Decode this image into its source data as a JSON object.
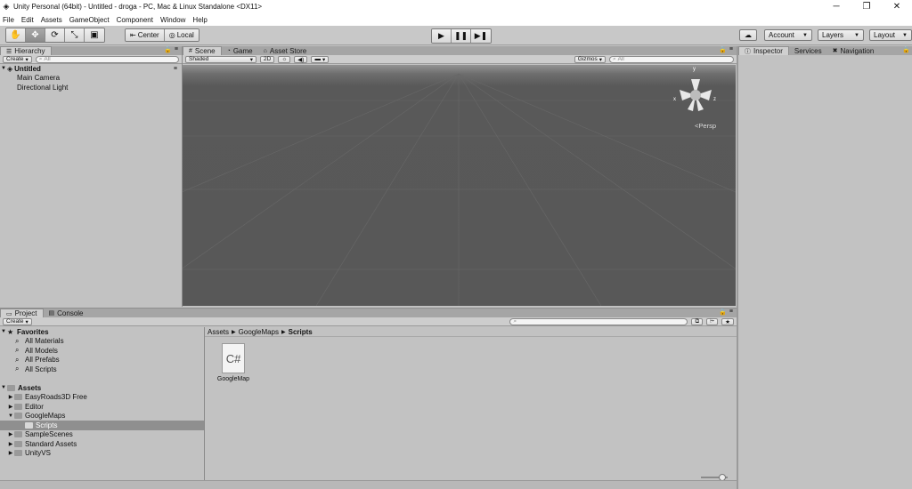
{
  "window": {
    "title": "Unity Personal (64bit) - Untitled - droga - PC, Mac & Linux Standalone <DX11>",
    "minimize": "─",
    "maximize": "❐",
    "close": "✕"
  },
  "menu": [
    "File",
    "Edit",
    "Assets",
    "GameObject",
    "Component",
    "Window",
    "Help"
  ],
  "toolbar": {
    "pivot_label": "Center",
    "space_label": "Local",
    "account_label": "Account",
    "layers_label": "Layers",
    "layout_label": "Layout"
  },
  "hierarchy": {
    "tab_label": "Hierarchy",
    "create_label": "Create",
    "search_placeholder": "All",
    "scene_name": "Untitled",
    "items": [
      "Main Camera",
      "Directional Light"
    ]
  },
  "scene": {
    "tabs": [
      "Scene",
      "Game",
      "Asset Store"
    ],
    "shading_mode": "Shaded",
    "mode_2d": "2D",
    "gizmos_label": "Gizmos",
    "search_placeholder": "All",
    "projection_label": "Persp",
    "axis_labels": {
      "x": "x",
      "y": "y",
      "z": "z"
    }
  },
  "inspector": {
    "tabs": [
      "Inspector",
      "Services",
      "Navigation"
    ]
  },
  "project": {
    "tabs": [
      "Project",
      "Console"
    ],
    "create_label": "Create",
    "favorites_label": "Favorites",
    "favorites": [
      "All Materials",
      "All Models",
      "All Prefabs",
      "All Scripts"
    ],
    "assets_label": "Assets",
    "folders": [
      "EasyRoads3D Free",
      "Editor",
      "GoogleMaps"
    ],
    "subfolder": "Scripts",
    "folders_after": [
      "SampleScenes",
      "Standard Assets",
      "UnityVS"
    ],
    "breadcrumb": [
      "Assets",
      "GoogleMaps",
      "Scripts"
    ],
    "files": [
      {
        "name": "GoogleMap",
        "icon_text": "C#"
      }
    ]
  }
}
